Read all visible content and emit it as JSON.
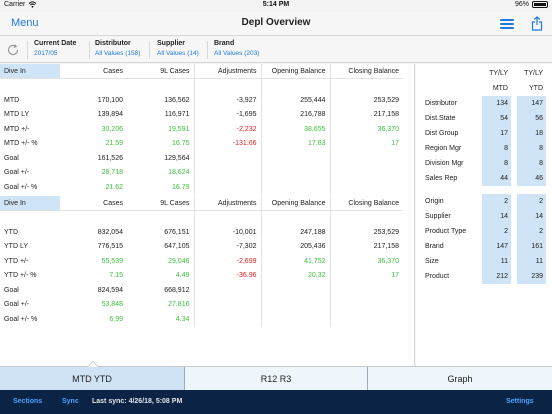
{
  "status": {
    "carrier": "Carrier",
    "time": "5:14 PM",
    "battery": "96%"
  },
  "nav": {
    "menu": "Menu",
    "title": "Depl Overview",
    "icons": [
      "list-icon",
      "share-icon"
    ]
  },
  "filters": [
    {
      "label": "Current Date",
      "value": "2017/05"
    },
    {
      "label": "Distributor",
      "value": "All Values (158)"
    },
    {
      "label": "Supplier",
      "value": "All Values (14)"
    },
    {
      "label": "Brand",
      "value": "All Values (203)"
    }
  ],
  "tables": {
    "headers": [
      "Dive In",
      "Cases",
      "9L Cases",
      "Adjustments",
      "Opening Balance",
      "Closing Balance"
    ],
    "mtd": [
      {
        "label": "MTD",
        "cells": [
          "170,100",
          "136,562",
          "-3,927",
          "255,444",
          "253,529"
        ]
      },
      {
        "label": "MTD LY",
        "cells": [
          "139,894",
          "116,971",
          "-1,695",
          "216,788",
          "217,158"
        ]
      },
      {
        "label": "MTD +/-",
        "cells": [
          "30,206",
          "19,591",
          "-2,232",
          "38,655",
          "36,370"
        ]
      },
      {
        "label": "MTD +/- %",
        "cells": [
          "21.59",
          "16.75",
          "-131.66",
          "17.83",
          "17"
        ]
      },
      {
        "label": "Goal",
        "cells": [
          "161,526",
          "129,564",
          "",
          "",
          ""
        ]
      },
      {
        "label": "Goal +/-",
        "cells": [
          "28,718",
          "18,624",
          "",
          "",
          ""
        ]
      },
      {
        "label": "Goal +/- %",
        "cells": [
          "21.62",
          "16.79",
          "",
          "",
          ""
        ]
      }
    ],
    "ytd": [
      {
        "label": "YTD",
        "cells": [
          "832,054",
          "676,151",
          "-10,001",
          "247,188",
          "253,529"
        ]
      },
      {
        "label": "YTD LY",
        "cells": [
          "776,515",
          "647,105",
          "-7,302",
          "205,436",
          "217,158"
        ]
      },
      {
        "label": "YTD +/-",
        "cells": [
          "55,539",
          "29,046",
          "-2,699",
          "41,752",
          "36,370"
        ]
      },
      {
        "label": "YTD +/- %",
        "cells": [
          "7.15",
          "4.49",
          "-36.96",
          "20.32",
          "17"
        ]
      },
      {
        "label": "Goal",
        "cells": [
          "824,594",
          "668,912",
          "",
          "",
          ""
        ]
      },
      {
        "label": "Goal +/-",
        "cells": [
          "53,848",
          "27,816",
          "",
          "",
          ""
        ]
      },
      {
        "label": "Goal +/- %",
        "cells": [
          "6.99",
          "4.34",
          "",
          "",
          ""
        ]
      }
    ],
    "color_rows": [
      2,
      3,
      5,
      6
    ]
  },
  "side": {
    "col_headers_top": [
      "TY/LY",
      "TY/LY"
    ],
    "col_headers": [
      "MTD",
      "YTD"
    ],
    "group1": [
      {
        "label": "Distributor",
        "mtd": "134",
        "ytd": "147"
      },
      {
        "label": "Dist.State",
        "mtd": "54",
        "ytd": "56"
      },
      {
        "label": "Dist Group",
        "mtd": "17",
        "ytd": "18"
      },
      {
        "label": "Region Mgr",
        "mtd": "8",
        "ytd": "8"
      },
      {
        "label": "Division Mgr",
        "mtd": "8",
        "ytd": "8"
      },
      {
        "label": "Sales Rep",
        "mtd": "44",
        "ytd": "46"
      }
    ],
    "group2": [
      {
        "label": "Origin",
        "mtd": "2",
        "ytd": "2"
      },
      {
        "label": "Supplier",
        "mtd": "14",
        "ytd": "14"
      },
      {
        "label": "Product Type",
        "mtd": "2",
        "ytd": "2"
      },
      {
        "label": "Brand",
        "mtd": "147",
        "ytd": "161"
      },
      {
        "label": "Size",
        "mtd": "11",
        "ytd": "11"
      },
      {
        "label": "Product",
        "mtd": "212",
        "ytd": "239"
      }
    ]
  },
  "bottom_tabs": [
    {
      "label": "MTD YTD",
      "active": true
    },
    {
      "label": "R12 R3",
      "active": false
    },
    {
      "label": "Graph",
      "active": false
    }
  ],
  "toolbar": {
    "sections": "Sections",
    "sync": "Sync",
    "last_sync": "Last sync: 4/26/18, 5:08 PM",
    "settings": "Settings"
  },
  "colors": {
    "accent": "#1f7ae0",
    "positive": "#3cbf3c",
    "negative": "#e02020",
    "highlight": "#cfe4f6",
    "toolbar": "#0b2345"
  }
}
